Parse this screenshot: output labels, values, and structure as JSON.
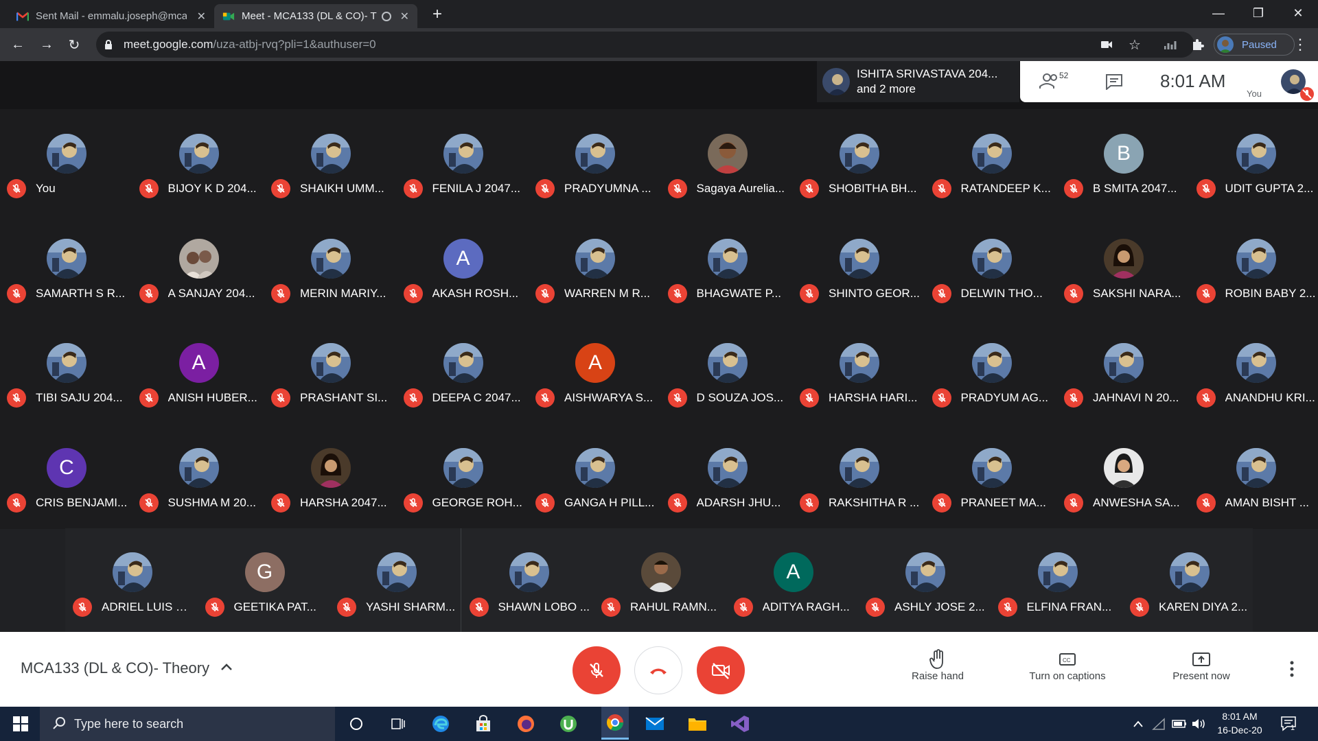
{
  "browser": {
    "tabs": [
      {
        "title": "Sent Mail - emmalu.joseph@mca",
        "icon": "gmail-icon",
        "active": false
      },
      {
        "title": "Meet - MCA133 (DL & CO)- T",
        "icon": "meet-icon",
        "active": true
      }
    ],
    "url_host": "meet.google.com",
    "url_path": "/uza-atbj-rvq?pli=1&authuser=0",
    "profile_status": "Paused"
  },
  "meet": {
    "speaker_line1": "ISHITA SRIVASTAVA 204...",
    "speaker_line2": "and 2 more",
    "participant_count": "52",
    "time": "8:01 AM",
    "you_label": "You",
    "participants": [
      {
        "name": "You",
        "avatar": "photo"
      },
      {
        "name": "BIJOY K D 204...",
        "avatar": "photo"
      },
      {
        "name": "SHAIKH UMM...",
        "avatar": "photo"
      },
      {
        "name": "FENILA J 2047...",
        "avatar": "photo"
      },
      {
        "name": "PRADYUMNA ...",
        "avatar": "photo"
      },
      {
        "name": "Sagaya Aurelia...",
        "avatar": "photo2"
      },
      {
        "name": "SHOBITHA BH...",
        "avatar": "photo"
      },
      {
        "name": "RATANDEEP K...",
        "avatar": "photo"
      },
      {
        "name": "B SMITA 2047...",
        "avatar": "letter",
        "letter": "B",
        "color": "#8aa4b3"
      },
      {
        "name": "UDIT GUPTA 2...",
        "avatar": "photo"
      },
      {
        "name": "SAMARTH S R...",
        "avatar": "photo"
      },
      {
        "name": "A SANJAY 204...",
        "avatar": "photo3"
      },
      {
        "name": "MERIN MARIY...",
        "avatar": "photo"
      },
      {
        "name": "AKASH ROSH...",
        "avatar": "letter",
        "letter": "A",
        "color": "#5c6bc0"
      },
      {
        "name": "WARREN M R...",
        "avatar": "photo"
      },
      {
        "name": "BHAGWATE P...",
        "avatar": "photo"
      },
      {
        "name": "SHINTO GEOR...",
        "avatar": "photo"
      },
      {
        "name": "DELWIN THO...",
        "avatar": "photo"
      },
      {
        "name": "SAKSHI NARA...",
        "avatar": "photo4"
      },
      {
        "name": "ROBIN BABY 2...",
        "avatar": "photo"
      },
      {
        "name": "TIBI SAJU 204...",
        "avatar": "photo"
      },
      {
        "name": "ANISH HUBER...",
        "avatar": "letter",
        "letter": "A",
        "color": "#7b1fa2"
      },
      {
        "name": "PRASHANT SI...",
        "avatar": "photo"
      },
      {
        "name": "DEEPA C 2047...",
        "avatar": "photo"
      },
      {
        "name": "AISHWARYA S...",
        "avatar": "letter",
        "letter": "A",
        "color": "#d84315"
      },
      {
        "name": "D SOUZA JOS...",
        "avatar": "photo"
      },
      {
        "name": "HARSHA HARI...",
        "avatar": "photo"
      },
      {
        "name": "PRADYUM AG...",
        "avatar": "photo"
      },
      {
        "name": "JAHNAVI N 20...",
        "avatar": "photo"
      },
      {
        "name": "ANANDHU KRI...",
        "avatar": "photo"
      },
      {
        "name": "CRIS BENJAMI...",
        "avatar": "letter",
        "letter": "C",
        "color": "#5e35b1"
      },
      {
        "name": "SUSHMA M 20...",
        "avatar": "photo"
      },
      {
        "name": "HARSHA 2047...",
        "avatar": "photo4"
      },
      {
        "name": "GEORGE ROH...",
        "avatar": "photo"
      },
      {
        "name": "GANGA H PILL...",
        "avatar": "photo"
      },
      {
        "name": "ADARSH JHU...",
        "avatar": "photo"
      },
      {
        "name": "RAKSHITHA R ...",
        "avatar": "photo"
      },
      {
        "name": "PRANEET MA...",
        "avatar": "photo"
      },
      {
        "name": "ANWESHA SA...",
        "avatar": "photo5"
      },
      {
        "name": "AMAN BISHT ...",
        "avatar": "photo"
      },
      {
        "name": "ADRIEL LUIS G...",
        "avatar": "photo"
      },
      {
        "name": "GEETIKA PAT...",
        "avatar": "letter",
        "letter": "G",
        "color": "#8d6e63"
      },
      {
        "name": "YASHI SHARM...",
        "avatar": "photo"
      },
      {
        "name": "SHAWN LOBO ...",
        "avatar": "photo"
      },
      {
        "name": "RAHUL RAMN...",
        "avatar": "photo6"
      },
      {
        "name": "ADITYA RAGH...",
        "avatar": "letter",
        "letter": "A",
        "color": "#00695c"
      },
      {
        "name": "ASHLY JOSE 2...",
        "avatar": "photo"
      },
      {
        "name": "ELFINA FRAN...",
        "avatar": "photo"
      },
      {
        "name": "KAREN DIYA 2...",
        "avatar": "photo"
      }
    ]
  },
  "controls": {
    "meeting_title": "MCA133 (DL & CO)- Theory",
    "raise_hand": "Raise hand",
    "captions": "Turn on captions",
    "present": "Present now"
  },
  "taskbar": {
    "search_placeholder": "Type here to search",
    "time": "8:01 AM",
    "date": "16-Dec-20",
    "notification_count": "1"
  },
  "colors": {
    "accent_red": "#ea4335",
    "meet_bg": "#202124",
    "taskbar_bg": "#15233a"
  }
}
